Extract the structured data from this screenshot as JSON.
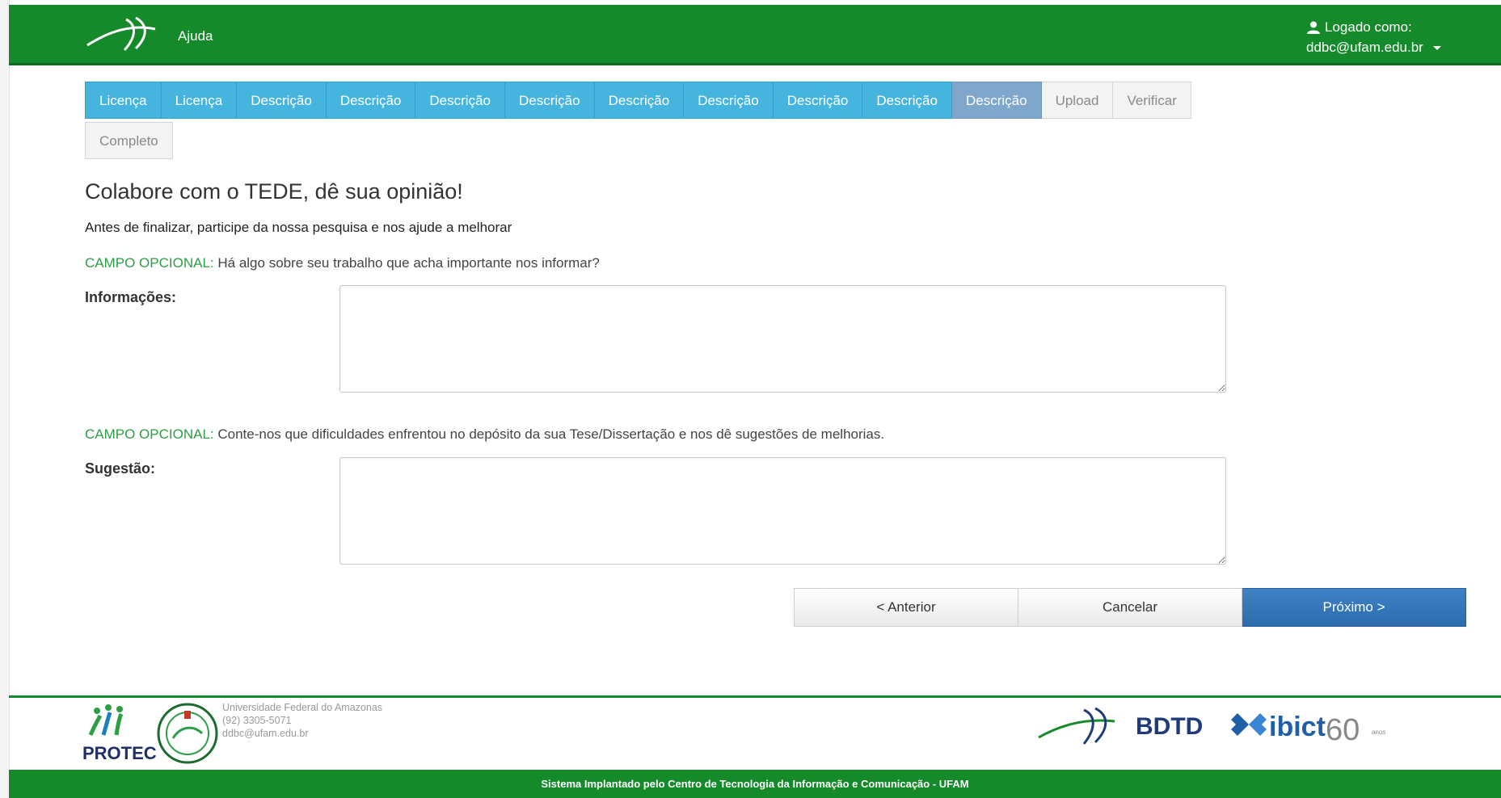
{
  "header": {
    "help_label": "Ajuda",
    "logged_as_label": "Logado como:",
    "user_email": "ddbc@ufam.edu.br"
  },
  "progress_tabs": [
    {
      "label": "Licença",
      "state": "done"
    },
    {
      "label": "Licença",
      "state": "done"
    },
    {
      "label": "Descrição",
      "state": "done"
    },
    {
      "label": "Descrição",
      "state": "done"
    },
    {
      "label": "Descrição",
      "state": "done"
    },
    {
      "label": "Descrição",
      "state": "done"
    },
    {
      "label": "Descrição",
      "state": "done"
    },
    {
      "label": "Descrição",
      "state": "done"
    },
    {
      "label": "Descrição",
      "state": "done"
    },
    {
      "label": "Descrição",
      "state": "done"
    },
    {
      "label": "Descrição",
      "state": "current"
    },
    {
      "label": "Upload",
      "state": "future"
    },
    {
      "label": "Verificar",
      "state": "future"
    },
    {
      "label": "Completo",
      "state": "future"
    }
  ],
  "survey": {
    "title": "Colabore com o TEDE, dê sua opinião!",
    "intro": "Antes de finalizar, participe da nossa pesquisa e nos ajude a melhorar",
    "optional_tag": "CAMPO OPCIONAL:",
    "q1_text": "Há algo sobre seu trabalho que acha importante nos informar?",
    "q1_label": "Informações:",
    "q1_value": "",
    "q2_text": "Conte-nos que dificuldades enfrentou no depósito da sua Tese/Dissertação e nos dê sugestões de melhorias.",
    "q2_label": "Sugestão:",
    "q2_value": ""
  },
  "buttons": {
    "previous": "< Anterior",
    "cancel": "Cancelar",
    "next": "Próximo >"
  },
  "footer": {
    "university": "Universidade Federal do Amazonas",
    "phone": "(92) 3305-5071",
    "email": "ddbc@ufam.edu.br",
    "protec_logo_text": "PROTEC",
    "bdtd_logo_text": "BDTD",
    "ibict_logo_text": "ibict",
    "ibict_years_text": "60",
    "ibict_anos_text": "anos",
    "bottom_text": "Sistema Implantado pelo Centro de Tecnologia da Informação e Comunicação - UFAM"
  },
  "colors": {
    "brand_green": "#158a2b",
    "tab_done": "#45b5e0",
    "tab_current": "#7fa7cc",
    "primary_button": "#337ab7",
    "optional_tag": "#2c9e44"
  }
}
